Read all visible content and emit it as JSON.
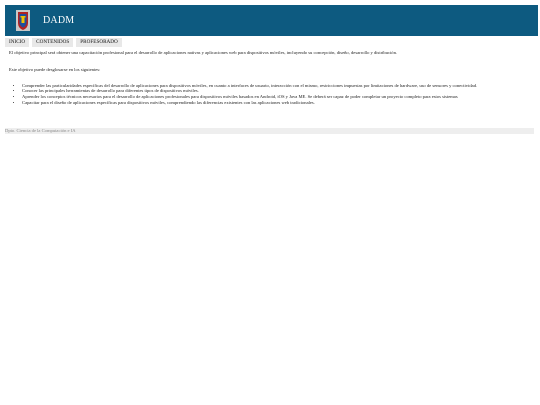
{
  "header": {
    "title": "DADM",
    "logo_icon": "university-shield-icon",
    "colors": {
      "bar": "#0d5a80",
      "title": "#ffffff"
    }
  },
  "nav": {
    "tabs": [
      {
        "label": "INICIO"
      },
      {
        "label": "CONTENIDOS"
      },
      {
        "label": "PROFESORADO"
      }
    ]
  },
  "content": {
    "intro": "El objetivo principal será obtener una capacitación profesional para el desarrollo de aplicaciones nativas y aplicaciones web para dispositivos móviles, incluyendo su concepción, diseño, desarrollo y distribución.",
    "subtitle": "Este objetivo puede desglosarse en los siguientes:",
    "objectives": [
      "Comprender las particularidades específicas del desarrollo de aplicaciones para dispositivos móviles, en cuanto a interfaces de usuario, interacción con el mismo, restricciones impuestas por limitaciones de hardware, uso de sensores y conectividad.",
      "Conocer las principales herramientas de desarrollo para diferentes tipos de dispositivos móviles.",
      "Aprender los conceptos técnicos necesarios para el desarrollo de aplicaciones profesionales para dispositivos móviles basados en Android, iOS y Java ME. Se deberá ser capaz de poder completar un proyecto completo para estos sistemas",
      "Capacitar para el diseño de aplicaciones específicas para dispositivos móviles, comprendiendo las diferencias existentes con las aplicaciones web tradicionales."
    ]
  },
  "footer": {
    "text": "Dpto. Ciencia de la Computación e IA"
  }
}
